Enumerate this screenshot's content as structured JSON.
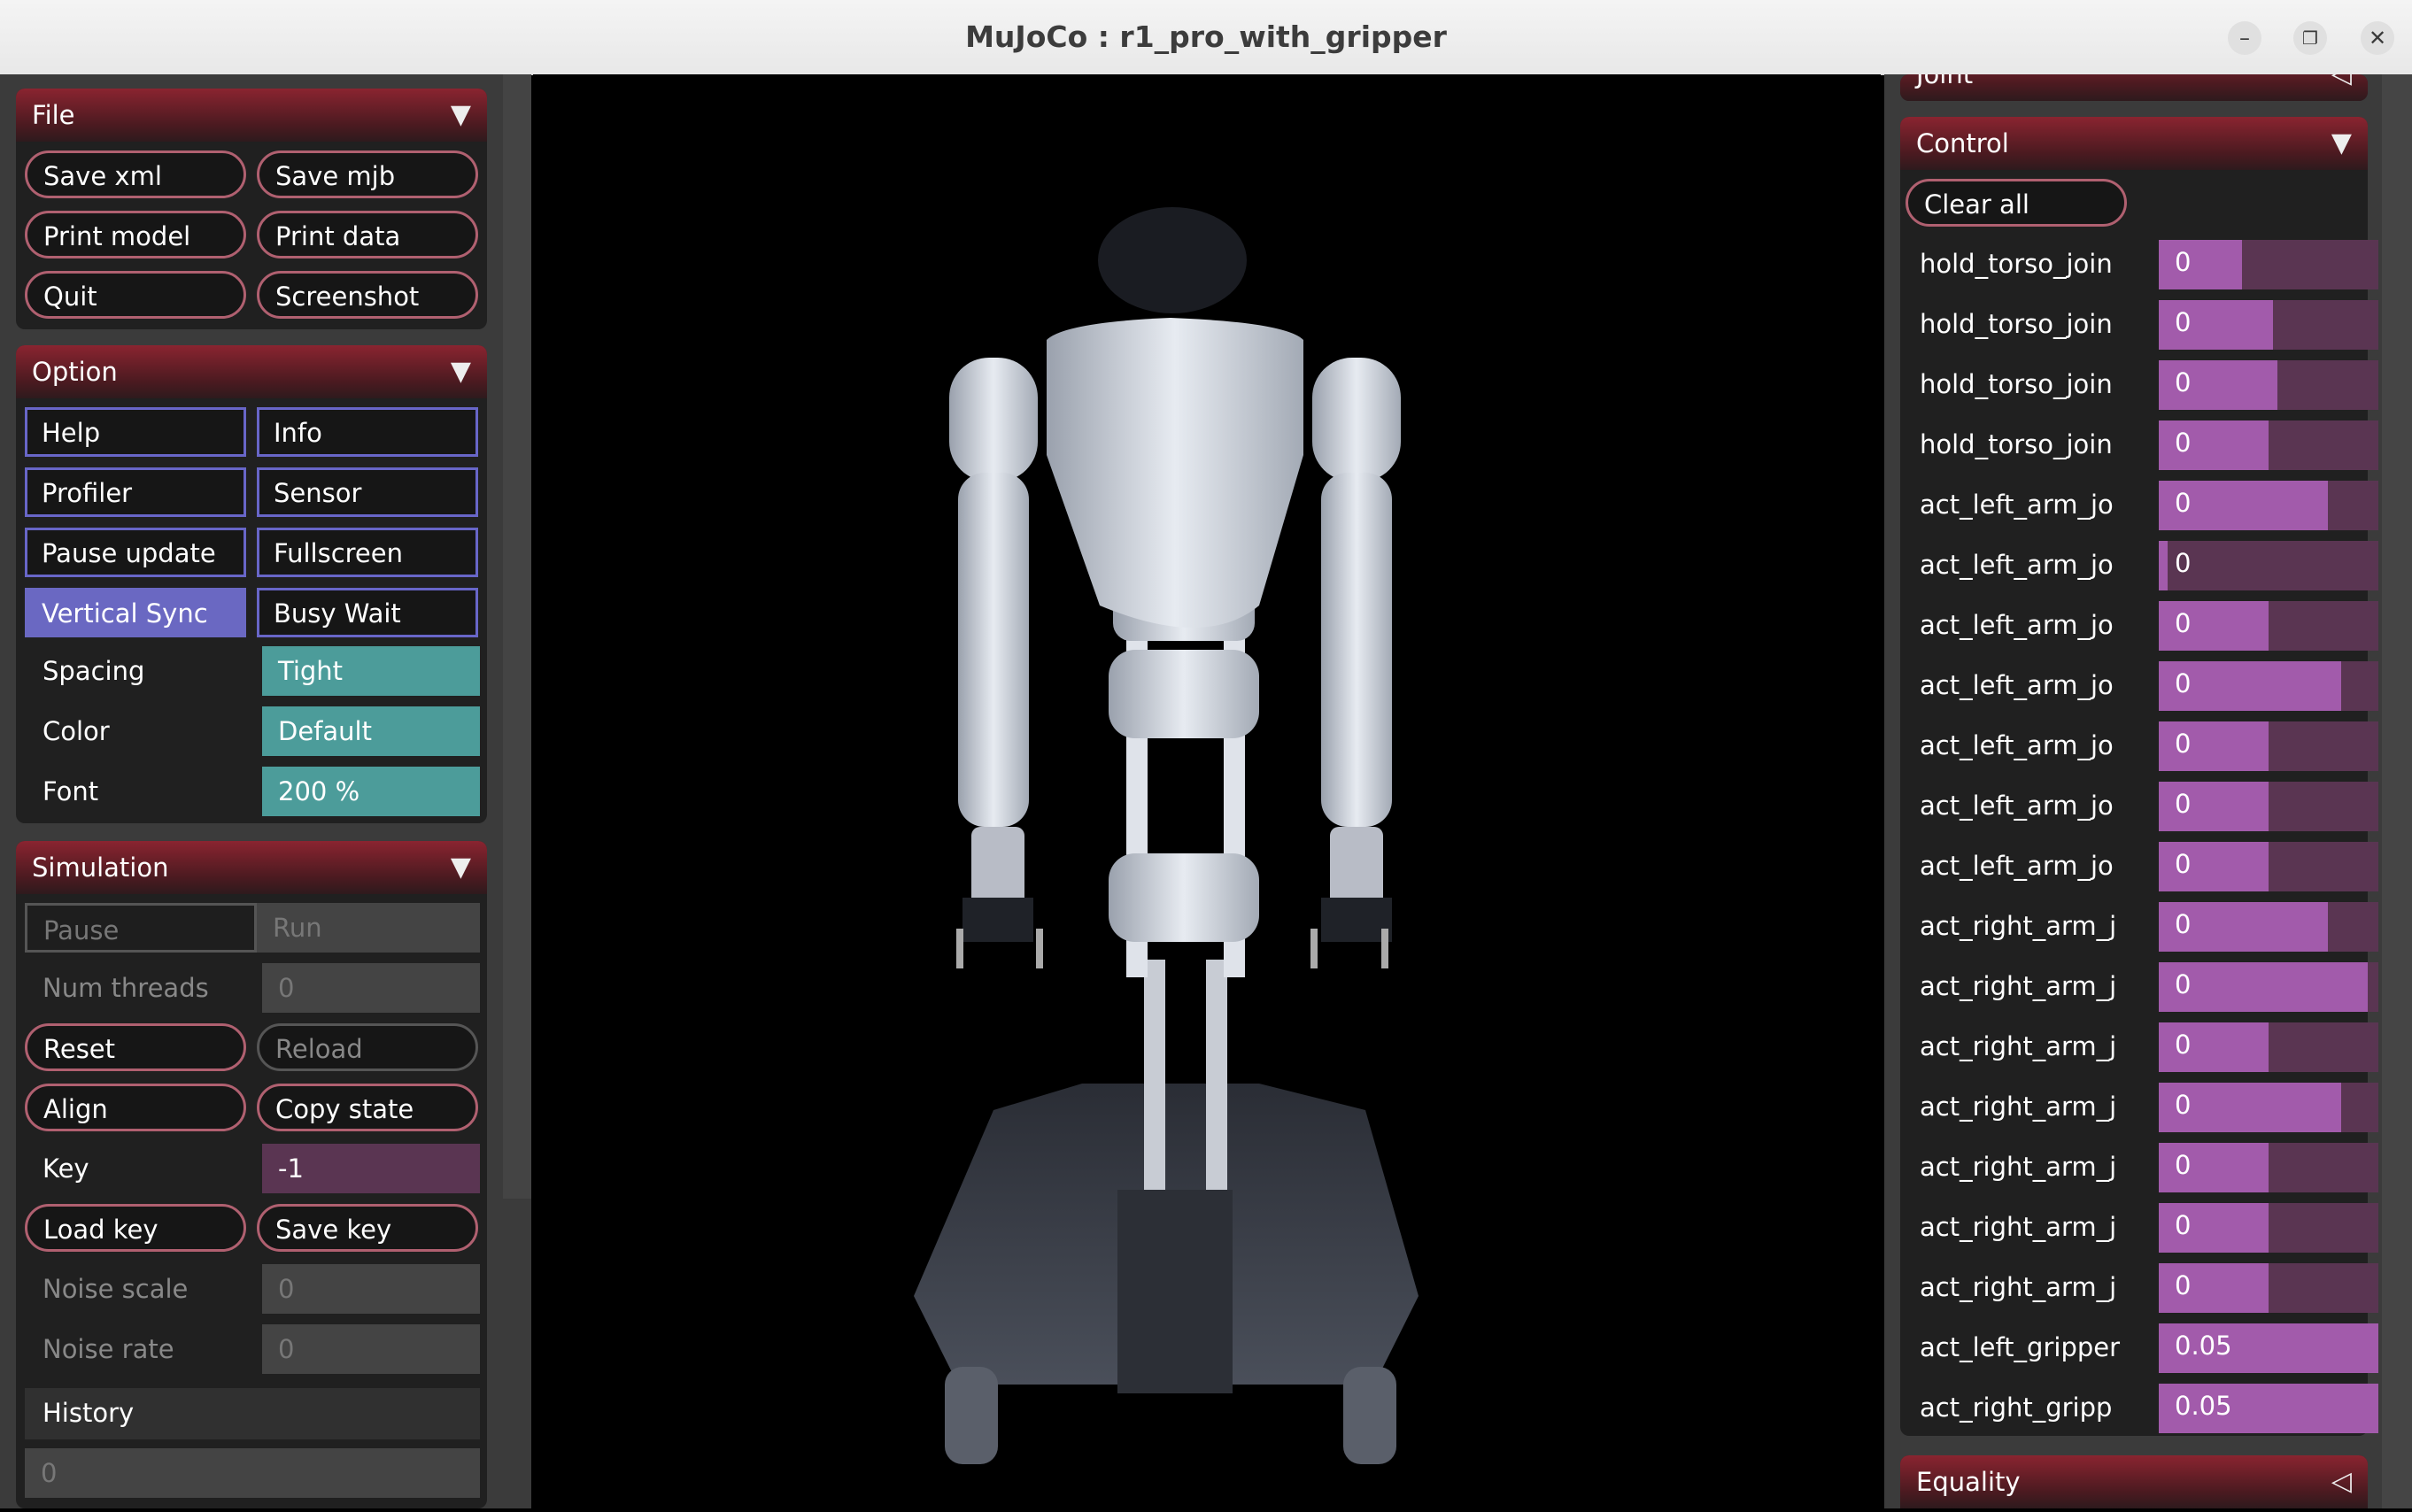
{
  "window": {
    "title": "MuJoCo : r1_pro_with_gripper",
    "controls": [
      "minimize-icon",
      "maximize-icon",
      "close-icon"
    ]
  },
  "file": {
    "title": "File",
    "buttons": [
      "Save xml",
      "Save mjb",
      "Print model",
      "Print data",
      "Quit",
      "Screenshot"
    ]
  },
  "option": {
    "title": "Option",
    "toggles": [
      "Help",
      "Info",
      "Profiler",
      "Sensor",
      "Pause update",
      "Fullscreen",
      "Vertical Sync",
      "Busy Wait"
    ],
    "active_toggle": "Vertical Sync",
    "spacing_label": "Spacing",
    "spacing_value": "Tight",
    "color_label": "Color",
    "color_value": "Default",
    "font_label": "Font",
    "font_value": "200 %"
  },
  "simulation": {
    "title": "Simulation",
    "pause": "Pause",
    "run": "Run",
    "num_threads_label": "Num threads",
    "num_threads_value": "0",
    "reset": "Reset",
    "reload": "Reload",
    "align": "Align",
    "copy_state": "Copy state",
    "key_label": "Key",
    "key_value": "-1",
    "load_key": "Load key",
    "save_key": "Save key",
    "noise_scale_label": "Noise scale",
    "noise_scale_value": "0",
    "noise_rate_label": "Noise rate",
    "noise_rate_value": "0",
    "history_label": "History",
    "history_value": "0"
  },
  "joint": {
    "title": "Joint"
  },
  "control": {
    "title": "Control",
    "clear_all": "Clear all",
    "rows": [
      {
        "name": "hold_torso_join",
        "value": "0",
        "fill": 0.38
      },
      {
        "name": "hold_torso_join",
        "value": "0",
        "fill": 0.52
      },
      {
        "name": "hold_torso_join",
        "value": "0",
        "fill": 0.54
      },
      {
        "name": "hold_torso_join",
        "value": "0",
        "fill": 0.5
      },
      {
        "name": "act_left_arm_jo",
        "value": "0",
        "fill": 0.77
      },
      {
        "name": "act_left_arm_jo",
        "value": "0",
        "fill": 0.04
      },
      {
        "name": "act_left_arm_jo",
        "value": "0",
        "fill": 0.5
      },
      {
        "name": "act_left_arm_jo",
        "value": "0",
        "fill": 0.83
      },
      {
        "name": "act_left_arm_jo",
        "value": "0",
        "fill": 0.5
      },
      {
        "name": "act_left_arm_jo",
        "value": "0",
        "fill": 0.5
      },
      {
        "name": "act_left_arm_jo",
        "value": "0",
        "fill": 0.5
      },
      {
        "name": "act_right_arm_j",
        "value": "0",
        "fill": 0.77
      },
      {
        "name": "act_right_arm_j",
        "value": "0",
        "fill": 0.95
      },
      {
        "name": "act_right_arm_j",
        "value": "0",
        "fill": 0.5
      },
      {
        "name": "act_right_arm_j",
        "value": "0",
        "fill": 0.83
      },
      {
        "name": "act_right_arm_j",
        "value": "0",
        "fill": 0.5
      },
      {
        "name": "act_right_arm_j",
        "value": "0",
        "fill": 0.5
      },
      {
        "name": "act_right_arm_j",
        "value": "0",
        "fill": 0.5
      },
      {
        "name": "act_left_gripper",
        "value": "0.05",
        "fill": 1.0
      },
      {
        "name": "act_right_gripp",
        "value": "0.05",
        "fill": 1.0
      }
    ]
  },
  "equality": {
    "title": "Equality"
  }
}
